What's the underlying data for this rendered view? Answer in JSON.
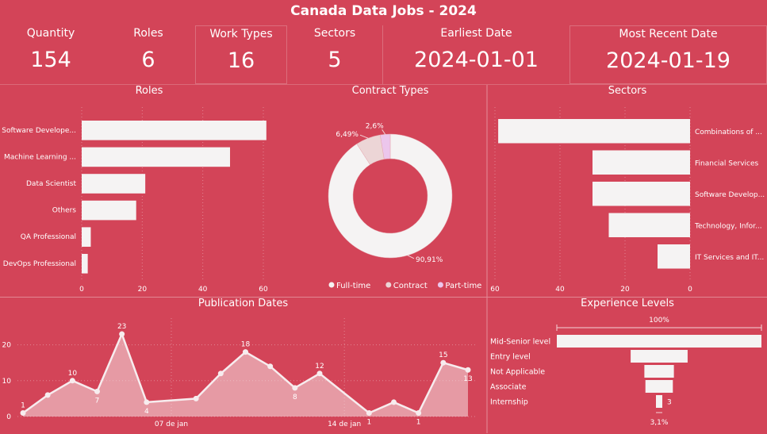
{
  "dashboard": {
    "title": "Canada Data Jobs - 2024",
    "kpis": [
      {
        "label": "Quantity",
        "value": "154"
      },
      {
        "label": "Roles",
        "value": "6"
      },
      {
        "label": "Work Types",
        "value": "16"
      },
      {
        "label": "Sectors",
        "value": "5"
      },
      {
        "label": "Earliest Date",
        "value": "2024-01-01"
      },
      {
        "label": "Most Recent Date",
        "value": "2024-01-19"
      }
    ]
  },
  "colors": {
    "background": "#d34458",
    "bar": "#f5f3f3",
    "fulltime": "#f5f3f3",
    "contract": "#ecd5d6",
    "parttime": "#ecc6ec"
  },
  "chart_data": [
    {
      "type": "bar",
      "orientation": "horizontal",
      "title": "Roles",
      "categories": [
        "Software Develope...",
        "Machine Learning ...",
        "Data Scientist",
        "Others",
        "QA Professional",
        "DevOps Professional"
      ],
      "values": [
        61,
        49,
        21,
        18,
        3,
        2
      ],
      "xticks": [
        0,
        20,
        40,
        60
      ],
      "xlim": [
        0,
        70
      ]
    },
    {
      "type": "pie",
      "title": "Contract Types",
      "labels": [
        "Full-time",
        "Contract",
        "Part-time"
      ],
      "values": [
        90.91,
        6.49,
        2.6
      ],
      "data_labels": [
        "90,91%",
        "6,49%",
        "2,6%"
      ],
      "donut": true,
      "legend": "bottom"
    },
    {
      "type": "bar",
      "orientation": "horizontal-reversed",
      "title": "Sectors",
      "categories": [
        "Combinations of ...",
        "Financial Services",
        "Software Develop...",
        "Technology, Infor...",
        "IT Services and IT..."
      ],
      "values": [
        59,
        30,
        30,
        25,
        10
      ],
      "xticks": [
        60,
        40,
        20,
        0
      ],
      "xlim": [
        0,
        62
      ]
    },
    {
      "type": "area",
      "title": "Publication Dates",
      "x": [
        "2024-01-01",
        "2024-01-02",
        "2024-01-03",
        "2024-01-04",
        "2024-01-05",
        "2024-01-06",
        "2024-01-08",
        "2024-01-09",
        "2024-01-10",
        "2024-01-11",
        "2024-01-12",
        "2024-01-13",
        "2024-01-15",
        "2024-01-16",
        "2024-01-17",
        "2024-01-18",
        "2024-01-19"
      ],
      "values": [
        1,
        6,
        10,
        7,
        23,
        4,
        5,
        12,
        18,
        14,
        8,
        12,
        1,
        4,
        1,
        15,
        13
      ],
      "data_labels": [
        "1",
        "",
        "10",
        "7",
        "23",
        "4",
        "",
        "",
        "18",
        "",
        "8",
        "12",
        "1",
        "",
        "1",
        "15",
        "13"
      ],
      "xtick_labels": [
        "07 de jan",
        "14 de jan"
      ],
      "yticks": [
        0,
        10,
        20
      ],
      "ylim": [
        0,
        25
      ]
    },
    {
      "type": "bar",
      "orientation": "funnel",
      "title": "Experience Levels",
      "categories": [
        "Mid-Senior level",
        "Entry level",
        "Not Applicable",
        "Associate",
        "Internship"
      ],
      "values": [
        97,
        27,
        14,
        13,
        3
      ],
      "top_label": "100%",
      "bottom_label": "3,1%",
      "end_value_label": "3"
    }
  ]
}
